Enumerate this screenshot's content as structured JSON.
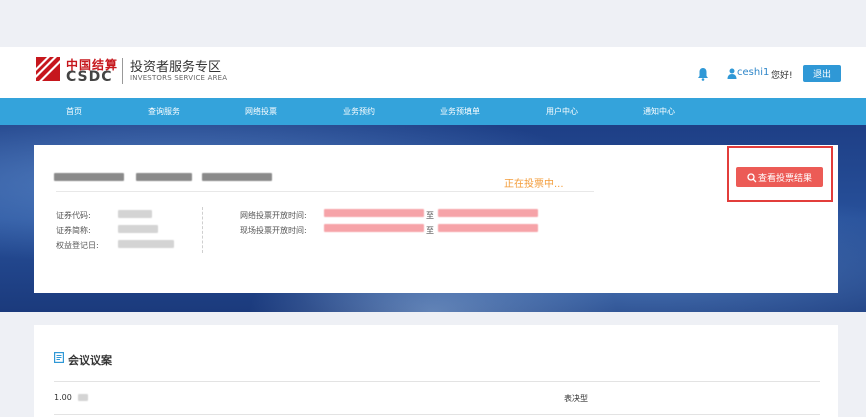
{
  "header": {
    "brand_cn": "中国结算",
    "brand_en": "CSDC",
    "area_cn": "投资者服务专区",
    "area_en": "INVESTORS SERVICE AREA",
    "user_name": "ceshi1",
    "greeting": "您好!",
    "logout_label": "退出"
  },
  "nav": {
    "items": [
      {
        "label": "首页"
      },
      {
        "label": "查询服务"
      },
      {
        "label": "网络投票"
      },
      {
        "label": "业务预约"
      },
      {
        "label": "业务预填单"
      },
      {
        "label": "用户中心"
      },
      {
        "label": "通知中心"
      }
    ]
  },
  "meeting": {
    "status": "正在投票中...",
    "result_button_label": "查看投票结果",
    "labels": {
      "code": "证券代码:",
      "abbr": "证券简称:",
      "record_date": "权益登记日:",
      "online_time": "网络投票开放时间:",
      "onsite_time": "现场投票开放时间:",
      "to": "至"
    }
  },
  "agenda": {
    "title": "会议议案",
    "rows": [
      {
        "no": "1.00",
        "type": "表决型"
      }
    ]
  },
  "colors": {
    "nav": "#34a3db",
    "status": "#f39c3a",
    "result_button": "#ec5b56",
    "highlight": "#e23d3b",
    "brand_red": "#c6171d"
  }
}
